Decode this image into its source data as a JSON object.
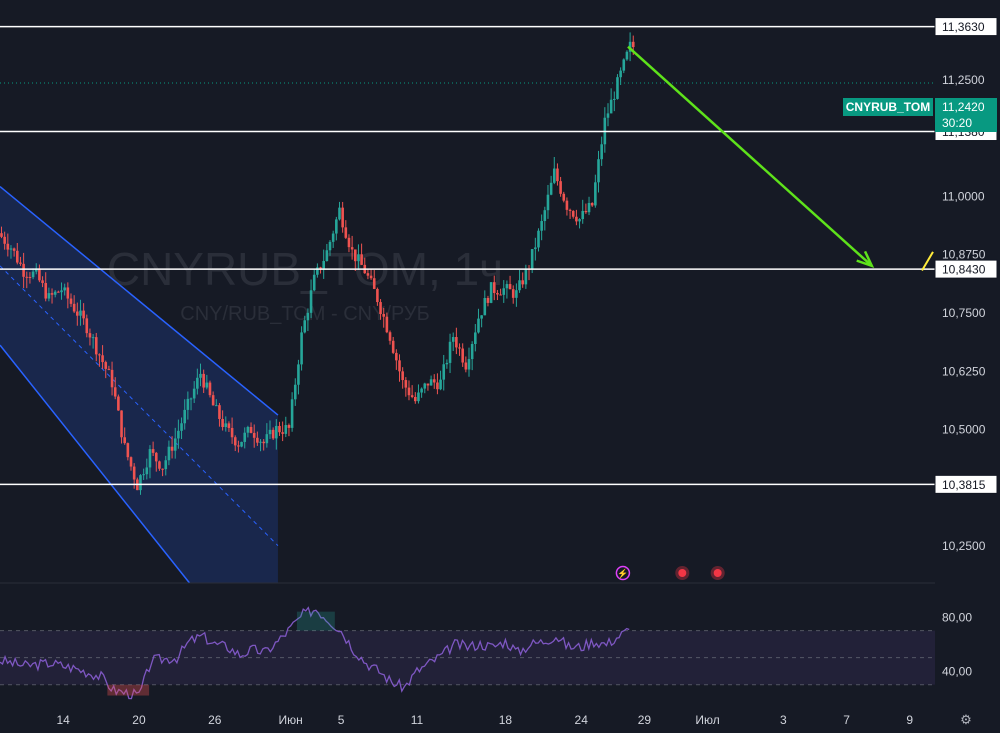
{
  "chart_data": {
    "type": "candlestick",
    "symbol_label": "CNYRUB_TOM",
    "watermark": {
      "title": "CNYRUB_TOM, 1ч",
      "subtitle": "CNY/RUB_TOM - CNY/РУБ"
    },
    "timeframe": "1ч",
    "current_price": "11,2420",
    "countdown": "30:20",
    "price_axis": {
      "ylim": [
        10.17,
        11.42
      ],
      "ticks": [
        {
          "value": 11.25,
          "label": "11,2500"
        },
        {
          "value": 11.0,
          "label": "11,0000"
        },
        {
          "value": 10.875,
          "label": "10,8750"
        },
        {
          "value": 10.75,
          "label": "10,7500"
        },
        {
          "value": 10.625,
          "label": "10,6250"
        },
        {
          "value": 10.5,
          "label": "10,5000"
        },
        {
          "value": 10.25,
          "label": "10,2500"
        }
      ]
    },
    "levels": [
      {
        "value": 11.363,
        "label": "11,3630"
      },
      {
        "value": 11.138,
        "label": "11,1380"
      },
      {
        "value": 10.843,
        "label": "10,8430"
      },
      {
        "value": 10.3815,
        "label": "10,3815"
      }
    ],
    "time_axis": {
      "xlim": [
        0,
        74
      ],
      "ticks": [
        {
          "x": 5,
          "label": "14"
        },
        {
          "x": 11,
          "label": "20"
        },
        {
          "x": 17,
          "label": "26"
        },
        {
          "x": 23,
          "label": "Июн"
        },
        {
          "x": 27,
          "label": "5"
        },
        {
          "x": 33,
          "label": "11"
        },
        {
          "x": 40,
          "label": "18"
        },
        {
          "x": 46,
          "label": "24"
        },
        {
          "x": 51,
          "label": "29"
        },
        {
          "x": 56,
          "label": "Июл"
        },
        {
          "x": 62,
          "label": "3"
        },
        {
          "x": 67,
          "label": "7"
        },
        {
          "x": 72,
          "label": "9"
        }
      ]
    },
    "price_series": [
      [
        0,
        10.92
      ],
      [
        1,
        10.89
      ],
      [
        2,
        10.84
      ],
      [
        3,
        10.83
      ],
      [
        4,
        10.78
      ],
      [
        5,
        10.8
      ],
      [
        6,
        10.76
      ],
      [
        7,
        10.72
      ],
      [
        8,
        10.66
      ],
      [
        9,
        10.6
      ],
      [
        10,
        10.46
      ],
      [
        11,
        10.38
      ],
      [
        12,
        10.45
      ],
      [
        13,
        10.42
      ],
      [
        14,
        10.48
      ],
      [
        15,
        10.55
      ],
      [
        16,
        10.62
      ],
      [
        17,
        10.55
      ],
      [
        18,
        10.5
      ],
      [
        19,
        10.47
      ],
      [
        20,
        10.5
      ],
      [
        21,
        10.47
      ],
      [
        22,
        10.5
      ],
      [
        23,
        10.5
      ],
      [
        24,
        10.7
      ],
      [
        25,
        10.82
      ],
      [
        26,
        10.88
      ],
      [
        27,
        10.97
      ],
      [
        28,
        10.88
      ],
      [
        29,
        10.84
      ],
      [
        30,
        10.78
      ],
      [
        31,
        10.7
      ],
      [
        32,
        10.6
      ],
      [
        33,
        10.56
      ],
      [
        34,
        10.6
      ],
      [
        35,
        10.6
      ],
      [
        36,
        10.7
      ],
      [
        37,
        10.64
      ],
      [
        38,
        10.74
      ],
      [
        39,
        10.8
      ],
      [
        40,
        10.8
      ],
      [
        41,
        10.79
      ],
      [
        42,
        10.85
      ],
      [
        43,
        10.94
      ],
      [
        44,
        11.05
      ],
      [
        45,
        10.98
      ],
      [
        46,
        10.95
      ],
      [
        47,
        10.98
      ],
      [
        48,
        11.16
      ],
      [
        49,
        11.24
      ],
      [
        50,
        11.32
      ]
    ],
    "channel": {
      "upper": [
        [
          0,
          11.02
        ],
        [
          22,
          10.53
        ]
      ],
      "lower": [
        [
          0,
          10.68
        ],
        [
          15,
          10.17
        ]
      ],
      "mid": [
        [
          0,
          10.85
        ],
        [
          22,
          10.25
        ]
      ],
      "right_x": 22,
      "color": "#2962ff"
    },
    "arrow": {
      "from": [
        49.7,
        11.32
      ],
      "to": [
        69,
        10.85
      ],
      "color": "#5ee21b"
    },
    "rsi": {
      "ylim": [
        15,
        100
      ],
      "ticks": [
        {
          "value": 80,
          "label": "80,00"
        },
        {
          "value": 40,
          "label": "40,00"
        }
      ],
      "band": [
        30,
        70
      ],
      "mid": 50,
      "values": [
        [
          0,
          48
        ],
        [
          2,
          44
        ],
        [
          4,
          46
        ],
        [
          6,
          42
        ],
        [
          8,
          36
        ],
        [
          9,
          26
        ],
        [
          10,
          24
        ],
        [
          11,
          22
        ],
        [
          12,
          48
        ],
        [
          14,
          50
        ],
        [
          15,
          62
        ],
        [
          16,
          66
        ],
        [
          17,
          60
        ],
        [
          18,
          58
        ],
        [
          19,
          52
        ],
        [
          20,
          56
        ],
        [
          21,
          54
        ],
        [
          22,
          62
        ],
        [
          23,
          72
        ],
        [
          24,
          82
        ],
        [
          25,
          86
        ],
        [
          26,
          78
        ],
        [
          27,
          70
        ],
        [
          28,
          56
        ],
        [
          29,
          46
        ],
        [
          30,
          40
        ],
        [
          31,
          32
        ],
        [
          32,
          28
        ],
        [
          33,
          40
        ],
        [
          34,
          46
        ],
        [
          35,
          52
        ],
        [
          36,
          60
        ],
        [
          37,
          58
        ],
        [
          38,
          60
        ],
        [
          39,
          58
        ],
        [
          40,
          62
        ],
        [
          41,
          54
        ],
        [
          42,
          60
        ],
        [
          43,
          62
        ],
        [
          44,
          66
        ],
        [
          45,
          58
        ],
        [
          46,
          58
        ],
        [
          47,
          62
        ],
        [
          48,
          60
        ],
        [
          49,
          66
        ],
        [
          50,
          72
        ]
      ]
    },
    "events": [
      {
        "x": 49.3,
        "kind": "flash"
      },
      {
        "x": 54,
        "kind": "record"
      },
      {
        "x": 56.8,
        "kind": "record"
      }
    ],
    "colors": {
      "background": "#161a25",
      "up": "#26a69a",
      "down": "#ef5350",
      "rsi": "#7e57c2",
      "label_bg": "#089981",
      "level_line": "#ffffff"
    }
  }
}
